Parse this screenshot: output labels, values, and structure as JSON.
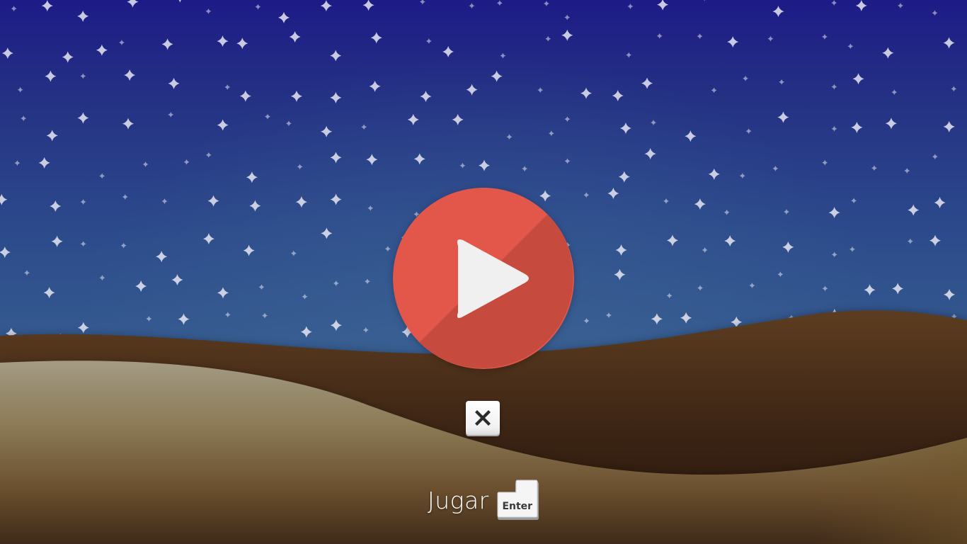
{
  "game": {
    "action_label": "Jugar",
    "enter_key_label": "Enter",
    "play_button_label": "",
    "close_button_label": ""
  },
  "icons": {
    "play": "play-icon",
    "close": "close-icon",
    "enter_key": "enter-key-icon",
    "star": "star-icon"
  },
  "colors": {
    "play_circle": "#e2574a",
    "play_circle_shadow": "#c64b3e",
    "play_triangle": "#f0f0f0",
    "sky_top": "#1d1b86",
    "sky_bottom": "#34598f",
    "dune_back": "#5a3b1f",
    "dune_front": "#a49a80"
  }
}
